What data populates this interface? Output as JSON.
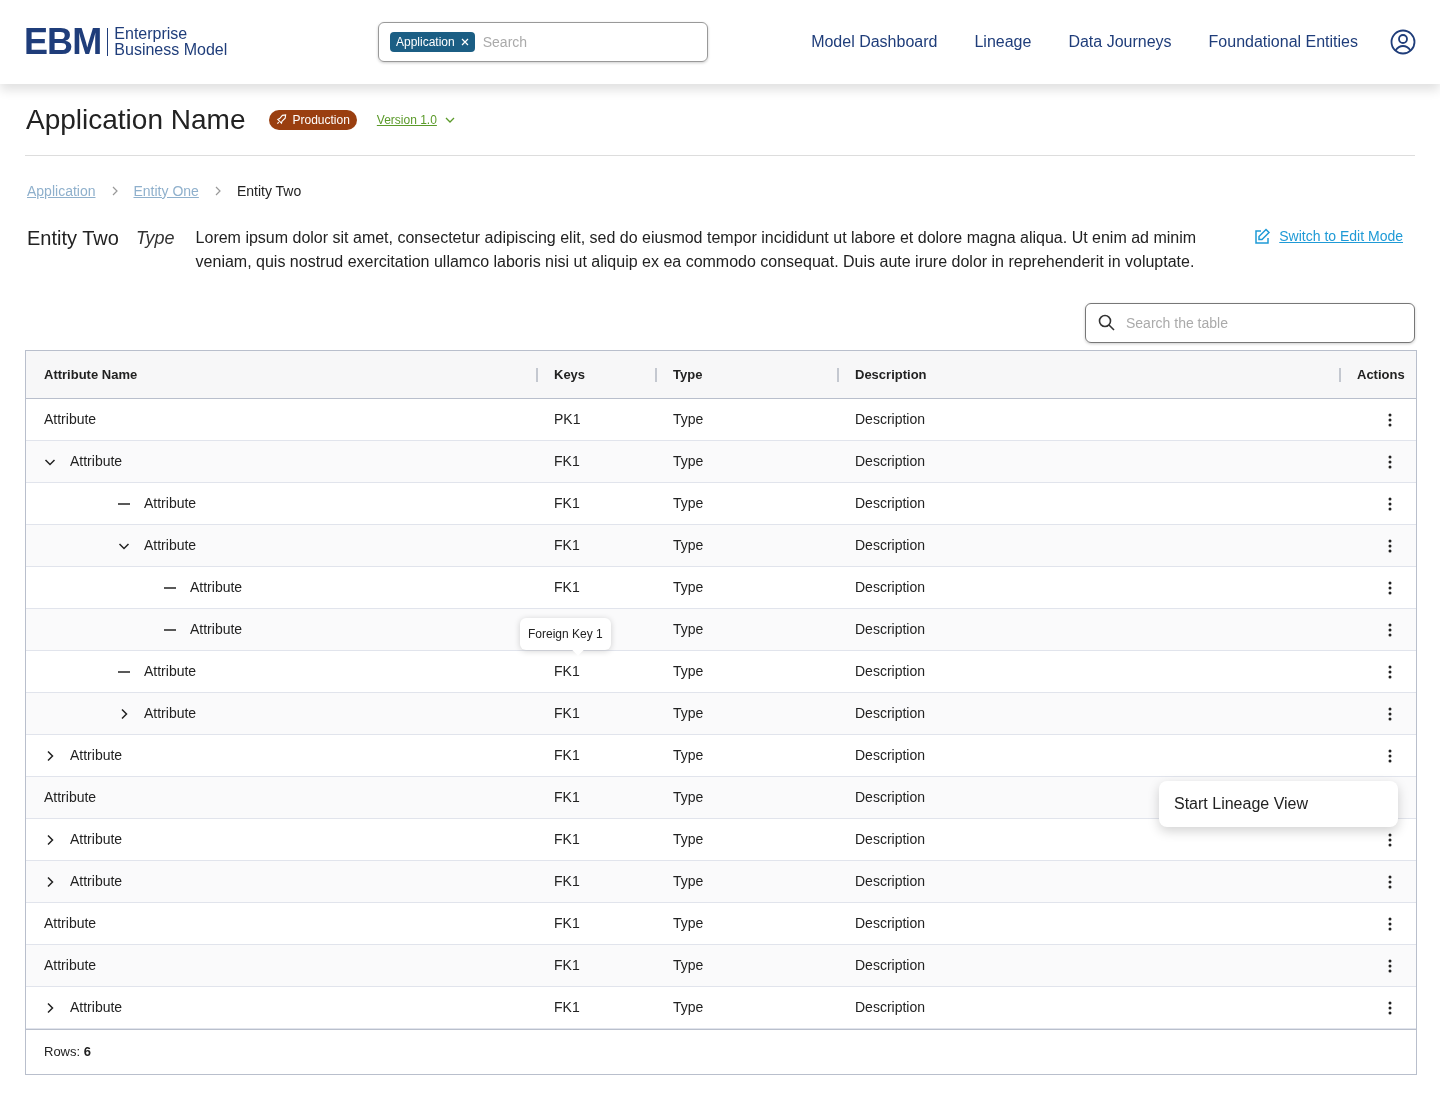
{
  "header": {
    "logo": {
      "mark": "EBM",
      "line_1": "Enterprise",
      "line_2": "Business Model"
    },
    "search": {
      "chip": "Application",
      "placeholder": "Search"
    },
    "nav": [
      "Model Dashboard",
      "Lineage",
      "Data Journeys",
      "Foundational Entities"
    ]
  },
  "page": {
    "title": "Application Name",
    "status": "Production",
    "version": "Version 1.0"
  },
  "breadcrumb": [
    {
      "label": "Application",
      "link": true
    },
    {
      "label": "Entity One",
      "link": true
    },
    {
      "label": "Entity Two",
      "link": false
    }
  ],
  "entity": {
    "name": "Entity Two",
    "type": "Type",
    "description": "Lorem ipsum dolor sit amet, consectetur adipiscing elit, sed do eiusmod tempor incididunt ut labore et dolore magna aliqua. Ut enim ad minim veniam, quis nostrud exercitation ullamco laboris nisi ut aliquip ex ea commodo consequat. Duis aute irure dolor in reprehenderit in voluptate.",
    "edit_link": "Switch to Edit Mode"
  },
  "table_search": {
    "placeholder": "Search the table"
  },
  "table": {
    "columns": [
      "Attribute Name",
      "Keys",
      "Type",
      "Description",
      "Actions"
    ],
    "rows": [
      {
        "kind": "leaf",
        "name": "Attribute",
        "keys": "PK1",
        "type": "Type",
        "description": "Description"
      },
      {
        "kind": "parent",
        "expanded": true,
        "name": "Attribute",
        "keys": "FK1",
        "type": "Type",
        "description": "Description",
        "children": [
          {
            "kind": "leaf",
            "name": "Attribute",
            "keys": "FK1",
            "type": "Type",
            "description": "Description"
          },
          {
            "kind": "parent",
            "expanded": true,
            "name": "Attribute",
            "keys": "FK1",
            "type": "Type",
            "description": "Description",
            "children": [
              {
                "kind": "leaf",
                "name": "Attribute",
                "keys": "FK1",
                "type": "Type",
                "description": "Description"
              },
              {
                "kind": "leaf",
                "name": "Attribute",
                "tooltip": "Foreign Key 1",
                "type": "Type",
                "description": "Description"
              }
            ]
          },
          {
            "kind": "leaf",
            "name": "Attribute",
            "keys": "FK1",
            "type": "Type",
            "description": "Description"
          },
          {
            "kind": "parent",
            "expanded": false,
            "name": "Attribute",
            "keys": "FK1",
            "type": "Type",
            "description": "Description"
          }
        ]
      },
      {
        "kind": "parent",
        "expanded": false,
        "name": "Attribute",
        "keys": "FK1",
        "type": "Type",
        "description": "Description"
      },
      {
        "kind": "leaf",
        "name": "Attribute",
        "keys": "FK1",
        "type": "Type",
        "description": "Description",
        "menu": [
          "Start Lineage View"
        ]
      },
      {
        "kind": "parent",
        "expanded": false,
        "name": "Attribute",
        "keys": "FK1",
        "type": "Type",
        "description": "Description"
      },
      {
        "kind": "parent",
        "expanded": false,
        "name": "Attribute",
        "keys": "FK1",
        "type": "Type",
        "description": "Description"
      },
      {
        "kind": "leaf",
        "name": "Attribute",
        "keys": "FK1",
        "type": "Type",
        "description": "Description"
      },
      {
        "kind": "leaf",
        "name": "Attribute",
        "keys": "FK1",
        "type": "Type",
        "description": "Description"
      },
      {
        "kind": "parent",
        "expanded": false,
        "name": "Attribute",
        "keys": "FK1",
        "type": "Type",
        "description": "Description"
      }
    ],
    "footer": {
      "label": "Rows:",
      "count": "6"
    }
  }
}
